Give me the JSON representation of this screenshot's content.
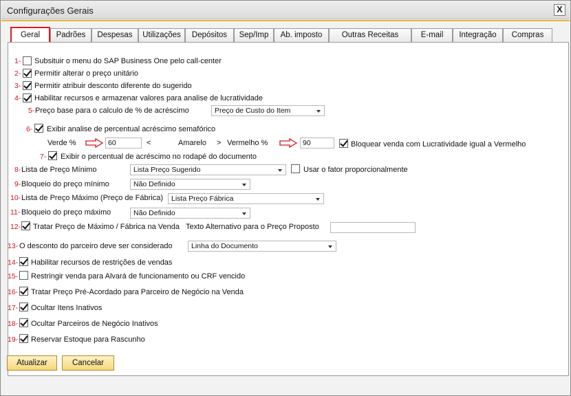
{
  "window": {
    "title": "Configurações Gerais",
    "close_label": "X"
  },
  "tabs": [
    {
      "label": "Geral"
    },
    {
      "label": "Padrões"
    },
    {
      "label": "Despesas"
    },
    {
      "label": "Utilizações"
    },
    {
      "label": "Depósitos"
    },
    {
      "label": "Sep/Imp"
    },
    {
      "label": "Ab. imposto"
    },
    {
      "label": "Outras Receitas"
    },
    {
      "label": "E-mail"
    },
    {
      "label": "Integração"
    },
    {
      "label": "Compras"
    }
  ],
  "active_tab": "Geral",
  "items": {
    "r1": {
      "num": "1-",
      "label": "Subsituir o menu do SAP Business One pelo call-center",
      "checked": false
    },
    "r2": {
      "num": "2-",
      "label": "Permitir alterar o preço unitário",
      "checked": true
    },
    "r3": {
      "num": "3-",
      "label": "Permitir atribuir desconto diferente do sugerido",
      "checked": true
    },
    "r4": {
      "num": "4-",
      "label": "Habilitar recursos e armazenar valores para analise de lucratividade",
      "checked": true
    },
    "r5": {
      "num": "5-",
      "label": "Preço base para o calculo de % de acréscimo",
      "value": "Preço de Custo do Item"
    },
    "r6": {
      "num": "6-",
      "label": "Exibir analise de percentual acréscimo semafórico",
      "checked": true
    },
    "sem": {
      "verde_label": "Verde %",
      "verde_value": "60",
      "lt": "<",
      "amarelo_label": "Amarelo",
      "gt": ">",
      "vermelho_label": "Vermelho %",
      "vermelho_value": "90",
      "bloquear_label": "Bloquear venda com Lucratividade igual a Vermelho",
      "bloquear_checked": true
    },
    "r7": {
      "num": "7-",
      "label": "Exibir o percentual de acréscimo no rodapé do documento",
      "checked": true
    },
    "r8": {
      "num": "8-",
      "label": "Lista de Preço Mínimo",
      "value": "Lista Preço Sugerido",
      "fator_label": "Usar o fator proporcionalmente",
      "fator_checked": false
    },
    "r9": {
      "num": "9-",
      "label": "Bloqueio do  preço mínimo",
      "value": "Não Definido"
    },
    "r10": {
      "num": "10-",
      "label": "Lista de Preço Máximo (Preço de Fábrica)",
      "value": "Lista Preço Fábrica"
    },
    "r11": {
      "num": "11-",
      "label": "Bloqueio do preço máximo",
      "value": "Não Definido"
    },
    "r12": {
      "num": "12-",
      "label": "Tratar Preço de Máximo / Fábrica na Venda",
      "checked": true,
      "alt_label": "Texto Alternativo para o Preço Proposto",
      "alt_value": ""
    },
    "r13": {
      "num": "13-",
      "label": "O desconto do parceiro deve ser considerado",
      "value": "Linha do Documento"
    },
    "r14": {
      "num": "14-",
      "label": "Habilitar recursos de restrições de vendas",
      "checked": true
    },
    "r15": {
      "num": "15-",
      "label": "Restringir venda para Alvará de funcionamento ou CRF vencido",
      "checked": false
    },
    "r16": {
      "num": "16-",
      "label": "Tratar Preço Pré-Acordado para Parceiro de Negócio na Venda",
      "checked": true
    },
    "r17": {
      "num": "17-",
      "label": "Ocultar Itens Inativos",
      "checked": true
    },
    "r18": {
      "num": "18-",
      "label": "Ocultar Parceiros de Negócio Inativos",
      "checked": true
    },
    "r19": {
      "num": "19-",
      "label": "Reservar Estoque para Rascunho",
      "checked": true
    }
  },
  "buttons": {
    "update": "Atualizar",
    "cancel": "Cancelar"
  },
  "colors": {
    "number_red": "#d0141b",
    "active_tab_border": "#e0191f",
    "button_gold": "#f6d77c",
    "title_accent": "#e8b33c"
  }
}
